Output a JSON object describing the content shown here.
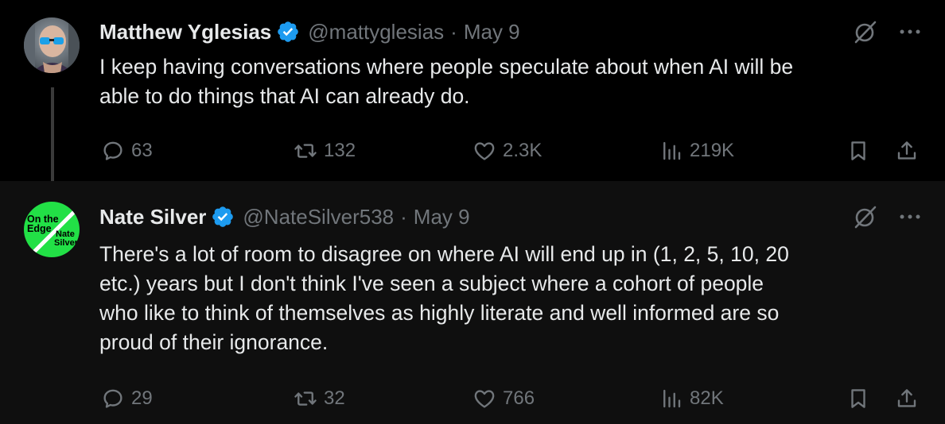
{
  "tweets": [
    {
      "name": "Matthew Yglesias",
      "handle": "@mattyglesias",
      "separator": "·",
      "date": "May 9",
      "text_lines": [
        "I keep having conversations where people speculate about when AI will be",
        "able to do things that AI can already do."
      ],
      "replies": "63",
      "retweets": "132",
      "likes": "2.3K",
      "views": "219K"
    },
    {
      "name": "Nate Silver",
      "handle": "@NateSilver538",
      "separator": "·",
      "date": "May 9",
      "text_lines": [
        "There's a lot of room to disagree on where AI will end up in (1, 2, 5, 10, 20",
        "etc.) years but I don't think I've seen a subject where a cohort of people",
        "who like to think of themselves as highly literate and well informed are so",
        "proud of their ignorance."
      ],
      "replies": "29",
      "retweets": "32",
      "likes": "766",
      "views": "82K",
      "avatar_text": {
        "line1": "On the",
        "line2": "Edge",
        "line3": "Nate",
        "line4": "Silver"
      }
    }
  ],
  "colors": {
    "background": "#000000",
    "reply_background": "#0f0f0f",
    "text": "#e7e9ea",
    "muted": "#71767b",
    "verified": "#1d9bf0",
    "avatar_green": "#22e046"
  },
  "icons": [
    "verified-badge-icon",
    "grok-icon",
    "more-icon",
    "reply-icon",
    "retweet-icon",
    "like-icon",
    "views-icon",
    "bookmark-icon",
    "share-icon"
  ]
}
